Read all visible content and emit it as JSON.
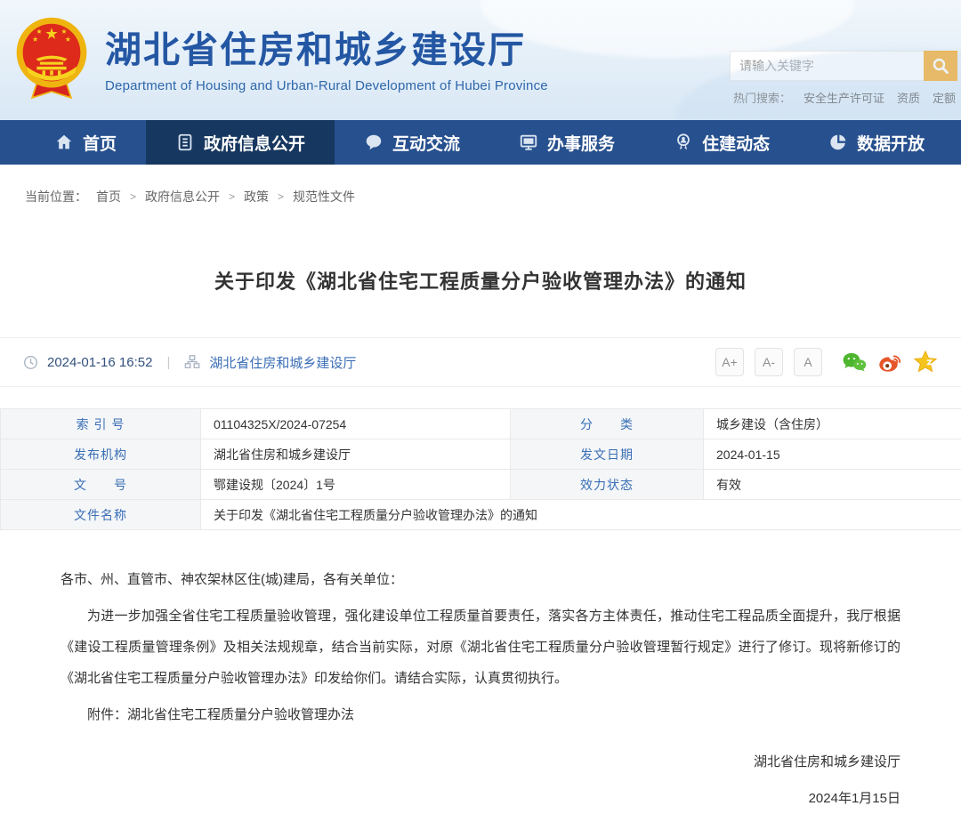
{
  "header": {
    "site_title": "湖北省住房和城乡建设厅",
    "site_subtitle": "Department of Housing and Urban-Rural Development of Hubei Province",
    "search_placeholder": "请输入关键字",
    "hot_search_label": "热门搜索：",
    "hot_searches": [
      "安全生产许可证",
      "资质",
      "定额"
    ]
  },
  "nav": {
    "items": [
      {
        "label": "首页"
      },
      {
        "label": "政府信息公开"
      },
      {
        "label": "互动交流"
      },
      {
        "label": "办事服务"
      },
      {
        "label": "住建动态"
      },
      {
        "label": "数据开放"
      }
    ]
  },
  "breadcrumb": {
    "label": "当前位置：",
    "separator": ">",
    "items": [
      "首页",
      "政府信息公开",
      "政策",
      "规范性文件"
    ]
  },
  "article": {
    "title": "关于印发《湖北省住宅工程质量分户验收管理办法》的通知",
    "publish_time": "2024-01-16 16:52",
    "source": "湖北省住房和城乡建设厅",
    "font_controls": {
      "larger": "A+",
      "smaller": "A-",
      "reset": "A"
    }
  },
  "meta_table": {
    "index_label": "索 引 号",
    "index_value": "01104325X/2024-07254",
    "category_label": "分　　类",
    "category_value": "城乡建设（含住房）",
    "agency_label": "发布机构",
    "agency_value": "湖北省住房和城乡建设厅",
    "issue_date_label": "发文日期",
    "issue_date_value": "2024-01-15",
    "doc_number_label": "文　　号",
    "doc_number_value": "鄂建设规〔2024〕1号",
    "status_label": "效力状态",
    "status_value": "有效",
    "doc_name_label": "文件名称",
    "doc_name_value": "关于印发《湖北省住宅工程质量分户验收管理办法》的通知"
  },
  "body": {
    "salutation": "各市、州、直管市、神农架林区住(城)建局，各有关单位：",
    "paragraph": "为进一步加强全省住宅工程质量验收管理，强化建设单位工程质量首要责任，落实各方主体责任，推动住宅工程品质全面提升，我厅根据《建设工程质量管理条例》及相关法规规章，结合当前实际，对原《湖北省住宅工程质量分户验收管理暂行规定》进行了修订。现将新修订的《湖北省住宅工程质量分户验收管理办法》印发给你们。请结合实际，认真贯彻执行。",
    "attachment": "附件：湖北省住宅工程质量分户验收管理办法",
    "signature_org": "湖北省住房和城乡建设厅",
    "signature_date": "2024年1月15日"
  },
  "colors": {
    "nav_blue": "#27508e",
    "nav_active_blue": "#16375f",
    "brand_blue": "#2457a3",
    "link_blue": "#3a6eb5",
    "accent_orange": "#f7a823",
    "wechat_green": "#4db52e",
    "weibo_orange": "#e6562a",
    "star_gold": "#f5c51f"
  }
}
